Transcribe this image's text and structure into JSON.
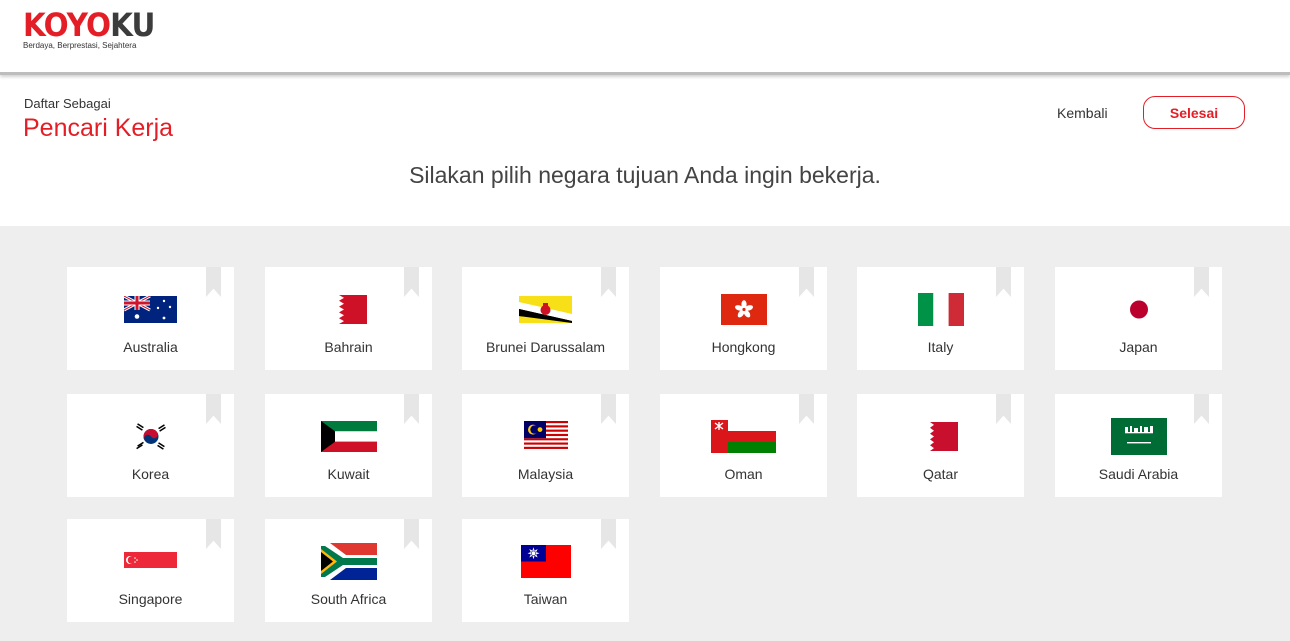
{
  "brand": {
    "logo_part1": "KOYO",
    "logo_part2": "KU",
    "tagline": "Berdaya, Berprestasi, Sejahtera",
    "accent_color": "#e41e26"
  },
  "header": {
    "register_as_label": "Daftar Sebagai",
    "register_as_value": "Pencari Kerja",
    "back_label": "Kembali",
    "done_label": "Selesai"
  },
  "instruction": "Silakan pilih negara tujuan Anda ingin bekerja.",
  "countries": [
    {
      "name": "Australia",
      "flag_icon": "australia-flag-icon"
    },
    {
      "name": "Bahrain",
      "flag_icon": "bahrain-flag-icon"
    },
    {
      "name": "Brunei Darussalam",
      "flag_icon": "brunei-flag-icon"
    },
    {
      "name": "Hongkong",
      "flag_icon": "hongkong-flag-icon"
    },
    {
      "name": "Italy",
      "flag_icon": "italy-flag-icon"
    },
    {
      "name": "Japan",
      "flag_icon": "japan-flag-icon"
    },
    {
      "name": "Korea",
      "flag_icon": "korea-flag-icon"
    },
    {
      "name": "Kuwait",
      "flag_icon": "kuwait-flag-icon"
    },
    {
      "name": "Malaysia",
      "flag_icon": "malaysia-flag-icon"
    },
    {
      "name": "Oman",
      "flag_icon": "oman-flag-icon"
    },
    {
      "name": "Qatar",
      "flag_icon": "qatar-flag-icon"
    },
    {
      "name": "Saudi Arabia",
      "flag_icon": "saudi-arabia-flag-icon"
    },
    {
      "name": "Singapore",
      "flag_icon": "singapore-flag-icon"
    },
    {
      "name": "South Africa",
      "flag_icon": "south-africa-flag-icon"
    },
    {
      "name": "Taiwan",
      "flag_icon": "taiwan-flag-icon"
    }
  ]
}
